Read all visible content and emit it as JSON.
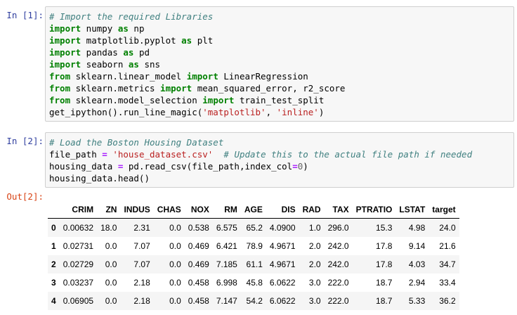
{
  "cells": [
    {
      "prompt": "In [1]:",
      "lines": [
        [
          [
            "cm",
            "# Import the required Libraries"
          ]
        ],
        [
          [
            "kw",
            "import"
          ],
          [
            "",
            " numpy "
          ],
          [
            "kw",
            "as"
          ],
          [
            "",
            " np"
          ]
        ],
        [
          [
            "kw",
            "import"
          ],
          [
            "",
            " matplotlib.pyplot "
          ],
          [
            "kw",
            "as"
          ],
          [
            "",
            " plt"
          ]
        ],
        [
          [
            "kw",
            "import"
          ],
          [
            "",
            " pandas "
          ],
          [
            "kw",
            "as"
          ],
          [
            "",
            " pd"
          ]
        ],
        [
          [
            "kw",
            "import"
          ],
          [
            "",
            " seaborn "
          ],
          [
            "kw",
            "as"
          ],
          [
            "",
            " sns"
          ]
        ],
        [
          [
            "kw",
            "from"
          ],
          [
            "",
            " sklearn.linear_model "
          ],
          [
            "kw",
            "import"
          ],
          [
            "",
            " LinearRegression"
          ]
        ],
        [
          [
            "kw",
            "from"
          ],
          [
            "",
            " sklearn.metrics "
          ],
          [
            "kw",
            "import"
          ],
          [
            "",
            " mean_squared_error, r2_score"
          ]
        ],
        [
          [
            "kw",
            "from"
          ],
          [
            "",
            " sklearn.model_selection "
          ],
          [
            "kw",
            "import"
          ],
          [
            "",
            " train_test_split"
          ]
        ],
        [
          [
            "",
            "get_ipython().run_line_magic("
          ],
          [
            "st",
            "'matplotlib'"
          ],
          [
            "",
            ", "
          ],
          [
            "st",
            "'inline'"
          ],
          [
            "",
            ")"
          ]
        ]
      ]
    },
    {
      "prompt": "In [2]:",
      "lines": [
        [
          [
            "cm",
            "# Load the Boston Housing Dataset"
          ]
        ],
        [
          [
            "",
            "file_path "
          ],
          [
            "op",
            "="
          ],
          [
            "",
            " "
          ],
          [
            "st",
            "'house_dataset.csv'"
          ],
          [
            "",
            "  "
          ],
          [
            "cm",
            "# Update this to the actual file path if needed"
          ]
        ],
        [
          [
            "",
            "housing_data "
          ],
          [
            "op",
            "="
          ],
          [
            "",
            " pd.read_csv(file_path,index_col"
          ],
          [
            "op",
            "="
          ],
          [
            "nu",
            "0"
          ],
          [
            "",
            ")"
          ]
        ],
        [
          [
            "",
            "housing_data.head()"
          ]
        ]
      ]
    }
  ],
  "output": {
    "prompt": "Out[2]:",
    "columns": [
      "",
      "CRIM",
      "ZN",
      "INDUS",
      "CHAS",
      "NOX",
      "RM",
      "AGE",
      "DIS",
      "RAD",
      "TAX",
      "PTRATIO",
      "LSTAT",
      "target"
    ],
    "rows": [
      [
        "0",
        "0.00632",
        "18.0",
        "2.31",
        "0.0",
        "0.538",
        "6.575",
        "65.2",
        "4.0900",
        "1.0",
        "296.0",
        "15.3",
        "4.98",
        "24.0"
      ],
      [
        "1",
        "0.02731",
        "0.0",
        "7.07",
        "0.0",
        "0.469",
        "6.421",
        "78.9",
        "4.9671",
        "2.0",
        "242.0",
        "17.8",
        "9.14",
        "21.6"
      ],
      [
        "2",
        "0.02729",
        "0.0",
        "7.07",
        "0.0",
        "0.469",
        "7.185",
        "61.1",
        "4.9671",
        "2.0",
        "242.0",
        "17.8",
        "4.03",
        "34.7"
      ],
      [
        "3",
        "0.03237",
        "0.0",
        "2.18",
        "0.0",
        "0.458",
        "6.998",
        "45.8",
        "6.0622",
        "3.0",
        "222.0",
        "18.7",
        "2.94",
        "33.4"
      ],
      [
        "4",
        "0.06905",
        "0.0",
        "2.18",
        "0.0",
        "0.458",
        "7.147",
        "54.2",
        "6.0622",
        "3.0",
        "222.0",
        "18.7",
        "5.33",
        "36.2"
      ]
    ]
  }
}
